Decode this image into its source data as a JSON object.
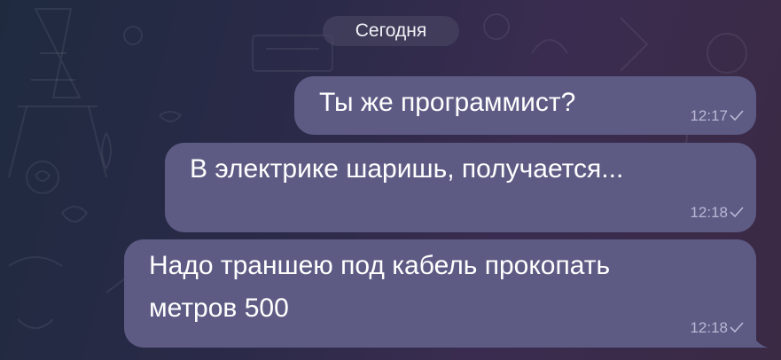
{
  "chat": {
    "date_separator": "Сегодня",
    "messages": [
      {
        "text": "Ты же программист?",
        "time": "12:17",
        "status": "sent"
      },
      {
        "text": "В электрике шаришь, получается...",
        "time": "12:18",
        "status": "sent"
      },
      {
        "text": "Надо траншею под кабель прокопать\nметров 500",
        "time": "12:18",
        "status": "sent"
      }
    ]
  },
  "colors": {
    "background_start": "#1f2a3f",
    "background_end": "#3b2a44",
    "bubble": "#5d5b84",
    "meta_text": "#b9b7d4"
  },
  "icons": {
    "status": "checkmark-icon",
    "wallpaper": "doodle-pattern"
  }
}
